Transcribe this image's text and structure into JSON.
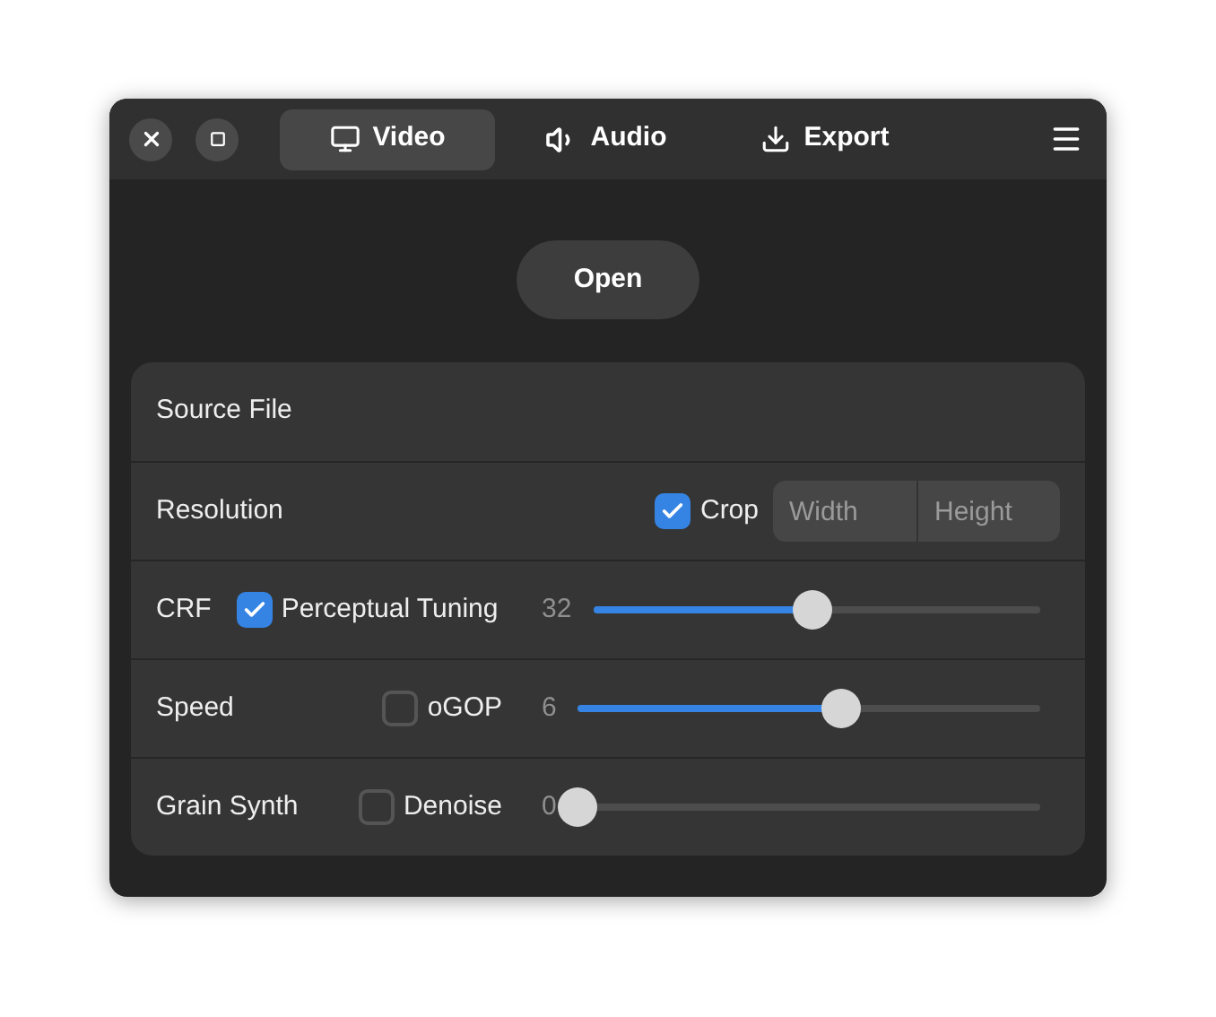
{
  "tabs": [
    {
      "label": "Video",
      "selected": true
    },
    {
      "label": "Audio",
      "selected": false
    },
    {
      "label": "Export",
      "selected": false
    }
  ],
  "open_button": "Open",
  "rows": [
    {
      "kind": "file",
      "label": "Source File"
    },
    {
      "kind": "resolution",
      "label": "Resolution",
      "checkbox": {
        "label": "Crop",
        "checked": true
      },
      "fields": [
        {
          "placeholder": "Width"
        },
        {
          "placeholder": "Height"
        }
      ]
    },
    {
      "kind": "slider",
      "label": "CRF",
      "checkbox": {
        "label": "Perceptual Tuning",
        "checked": true
      },
      "reading": "32",
      "level": 0.49
    },
    {
      "kind": "slider",
      "label": "Speed",
      "checkbox": {
        "label": "oGOP",
        "checked": false
      },
      "reading": "6",
      "level": 0.57
    },
    {
      "kind": "slider",
      "label": "Grain Synth",
      "checkbox": {
        "label": "Denoise",
        "checked": false
      },
      "reading": "0",
      "level": 0
    }
  ]
}
